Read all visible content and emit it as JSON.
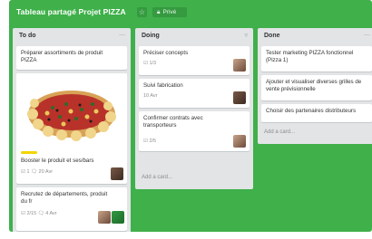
{
  "board": {
    "title": "Tableau partagé Projet PIZZA",
    "privacy_label": "Privé",
    "colors": {
      "background": "#3fb04a",
      "list": "#e2e4e6",
      "label_yellow": "#f2d600"
    }
  },
  "lists": [
    {
      "title": "To do",
      "cards": [
        {
          "text": "Préparer assortiments de produit PIZZA",
          "meta": ""
        },
        {
          "text": "Booster le produit et ses/bars",
          "meta": "☑ 1   🗨 20 Avr",
          "has_image": true
        },
        {
          "text": "Recrutez de départements, produit du fr",
          "meta": "☑ 2/15   🗨 4 Avr"
        }
      ]
    },
    {
      "title": "Doing",
      "cards": [
        {
          "text": "Préciser concepts",
          "meta": "☑ 1/3"
        },
        {
          "text": "Suivi fabrication",
          "meta": "10 Avr"
        },
        {
          "text": "Confirmer contrats avec transporteurs",
          "meta": "☑ 2/5"
        }
      ],
      "add_card": "Add a card..."
    },
    {
      "title": "Done",
      "cards": [
        {
          "text": "Tester marketing PIZZA fonctionnel (Pizza 1)",
          "meta": ""
        },
        {
          "text": "Ajouter et visualiser diverses grilles de vente prévisionnelle",
          "meta": ""
        },
        {
          "text": "Choisir des partenaires distributeurs",
          "meta": ""
        }
      ],
      "add_card": "Add a card..."
    }
  ],
  "icons": {
    "star": "star-icon",
    "lock": "lock-icon",
    "list_menu": "list-menu-icon"
  }
}
